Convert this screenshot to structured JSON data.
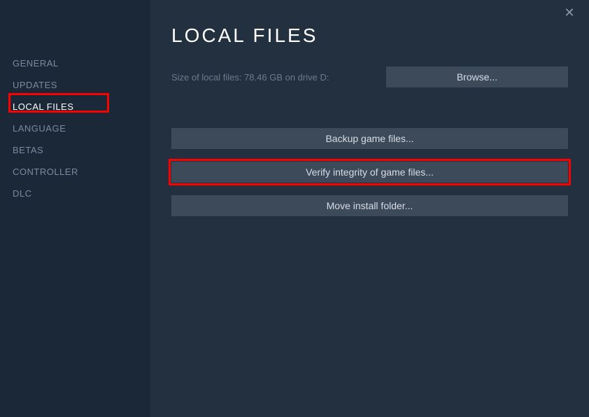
{
  "sidebar": {
    "items": [
      {
        "label": "General"
      },
      {
        "label": "Updates"
      },
      {
        "label": "Local Files"
      },
      {
        "label": "Language"
      },
      {
        "label": "Betas"
      },
      {
        "label": "Controller"
      },
      {
        "label": "DLC"
      }
    ]
  },
  "main": {
    "title": "LOCAL FILES",
    "size_info": "Size of local files: 78.46 GB on drive D:",
    "browse_label": "Browse...",
    "backup_label": "Backup game files...",
    "verify_label": "Verify integrity of game files...",
    "move_label": "Move install folder..."
  }
}
